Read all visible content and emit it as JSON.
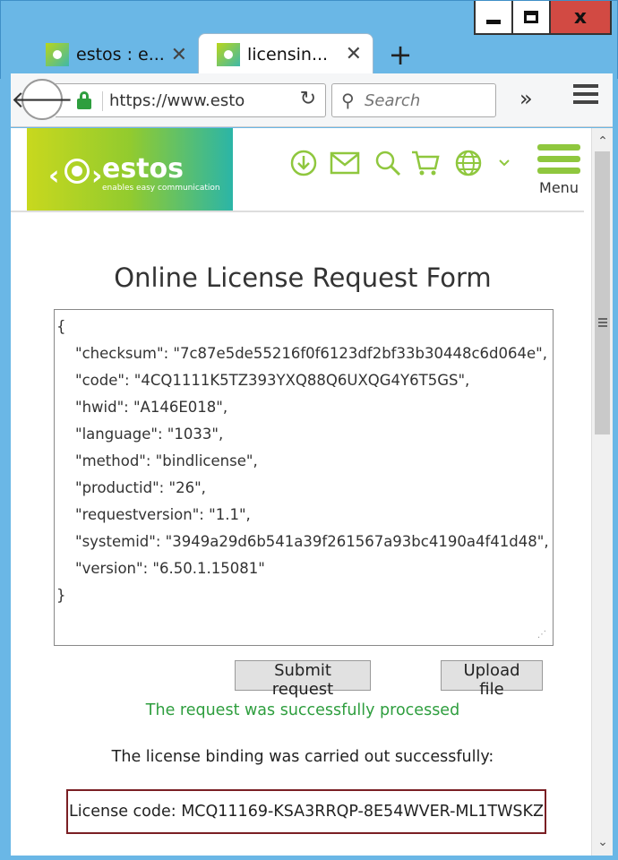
{
  "browser": {
    "tabs": [
      {
        "title": "estos : e...",
        "active": false
      },
      {
        "title": "licensin...",
        "active": true
      }
    ],
    "new_tab": "+",
    "url": "https://www.esto",
    "search_placeholder": "Search",
    "overflow": "»",
    "window_controls": {
      "close": "x"
    }
  },
  "site": {
    "logo_name": "estos",
    "logo_tagline": "enables easy communication",
    "menu_label": "Menu",
    "accent_color": "#8fc73e"
  },
  "form": {
    "title": "Online License Request Form",
    "json_text": "{\n    \"checksum\": \"7c87e5de55216f0f6123df2bf33b30448c6d064e\",\n    \"code\": \"4CQ1111K5TZ393YXQ88Q6UXQG4Y6T5GS\",\n    \"hwid\": \"A146E018\",\n    \"language\": \"1033\",\n    \"method\": \"bindlicense\",\n    \"productid\": \"26\",\n    \"requestversion\": \"1.1\",\n    \"systemid\": \"3949a29d6b541a39f261567a93bc4190a4f41d48\",\n    \"version\": \"6.50.1.15081\"\n}",
    "submit_label": "Submit request",
    "upload_label": "Upload file",
    "status_message": "The request was successfully processed",
    "binding_message": "The license binding was carried out successfully:",
    "license_code": "License code: MCQ11169-KSA3RRQP-8E54WVER-ML1TWSKZ",
    "status_color": "#2e9e3e",
    "license_border_color": "#7a1f24"
  }
}
